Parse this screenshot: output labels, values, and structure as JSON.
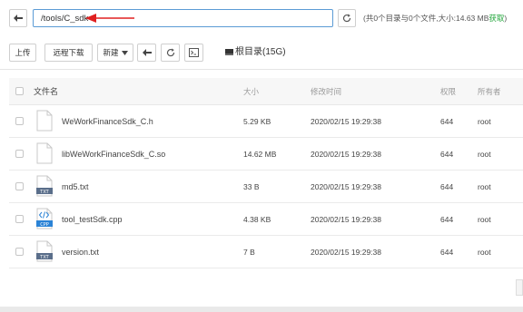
{
  "path_bar": {
    "path": "/tools/C_sdk",
    "info_prefix": "(共0个目录与0个文件,大小:14.63 MB",
    "fetch_label": "获取",
    "info_suffix": ")"
  },
  "toolbar": {
    "upload": "上传",
    "remote_download": "远程下载",
    "new": "新建",
    "root_dir": "根目录(15G)"
  },
  "table": {
    "headers": {
      "name": "文件名",
      "size": "大小",
      "modified": "修改时间",
      "perm": "权限",
      "owner": "所有者"
    },
    "rows": [
      {
        "name": "WeWorkFinanceSdk_C.h",
        "size": "5.29 KB",
        "modified": "2020/02/15 19:29:38",
        "perm": "644",
        "owner": "root",
        "icon": "blank-file-icon"
      },
      {
        "name": "libWeWorkFinanceSdk_C.so",
        "size": "14.62 MB",
        "modified": "2020/02/15 19:29:38",
        "perm": "644",
        "owner": "root",
        "icon": "blank-file-icon"
      },
      {
        "name": "md5.txt",
        "size": "33 B",
        "modified": "2020/02/15 19:29:38",
        "perm": "644",
        "owner": "root",
        "icon": "txt-file-icon",
        "icon_label": "TXT"
      },
      {
        "name": "tool_testSdk.cpp",
        "size": "4.38 KB",
        "modified": "2020/02/15 19:29:38",
        "perm": "644",
        "owner": "root",
        "icon": "cpp-file-icon",
        "icon_label": "CPP"
      },
      {
        "name": "version.txt",
        "size": "7 B",
        "modified": "2020/02/15 19:29:38",
        "perm": "644",
        "owner": "root",
        "icon": "txt-file-icon",
        "icon_label": "TXT"
      }
    ]
  },
  "colors": {
    "accent": "#5b9bd5",
    "fetch": "#20a53a",
    "arrow": "#e02020"
  }
}
